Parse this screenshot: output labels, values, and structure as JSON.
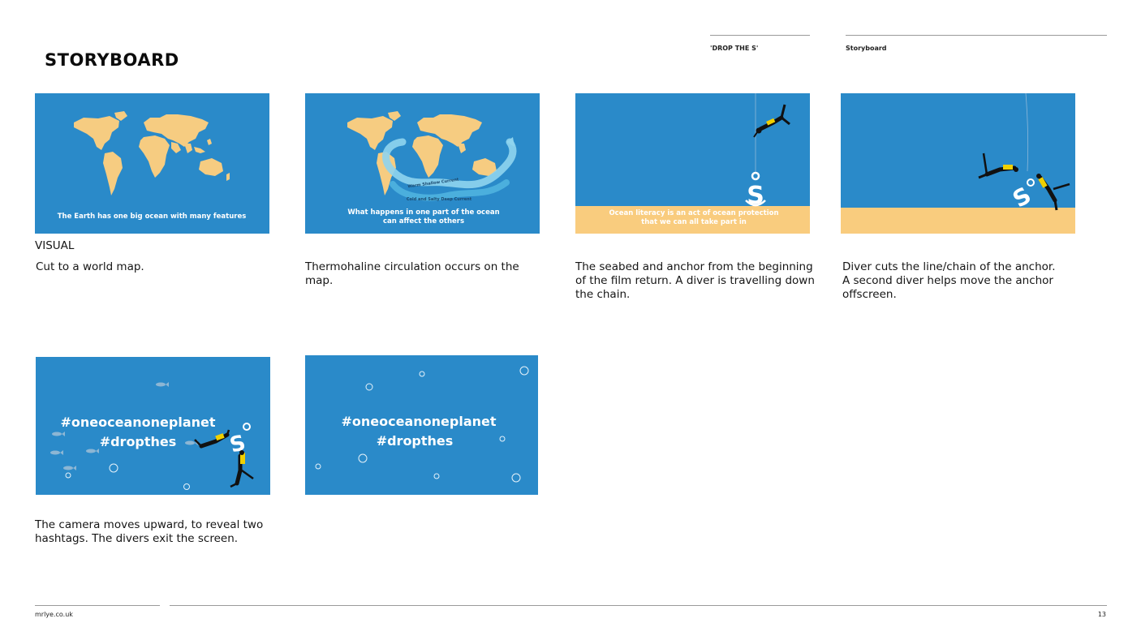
{
  "page": {
    "title": "STORYBOARD",
    "project_label": "'DROP THE S'",
    "section_label": "Storyboard",
    "visual_label": "VISUAL",
    "footer_site": "mrlye.co.uk",
    "page_number": "13"
  },
  "frames": [
    {
      "overlay_lines": [
        "The Earth has one big ocean with many features"
      ],
      "caption_lines": [
        "Cut to a world map."
      ]
    },
    {
      "overlay_lines": [
        "What happens in one part of the ocean",
        "can affect the others"
      ],
      "current_labels": [
        "Warm Shallow Current",
        "Cold and Salty Deep Current"
      ],
      "caption_lines": [
        "Thermohaline circulation occurs on the",
        "map."
      ]
    },
    {
      "overlay_lines": [
        "Ocean literacy is an act of ocean protection",
        "that we can all take part in"
      ],
      "caption_lines": [
        "The seabed and anchor from the beginning",
        "of the film return. A diver is travelling down",
        "the chain."
      ]
    },
    {
      "overlay_lines": [],
      "caption_lines": [
        "Diver cuts the line/chain of the anchor.",
        "A second diver helps move the anchor",
        "offscreen."
      ]
    },
    {
      "overlay_lines": [
        "#oneoceanoneplanet",
        "#dropthes"
      ],
      "caption_lines": [
        "The camera moves upward, to reveal two",
        "hashtags. The divers exit the screen."
      ]
    },
    {
      "overlay_lines": [
        "#oneoceanoneplanet",
        "#dropthes"
      ],
      "caption_lines": []
    }
  ],
  "colors": {
    "ocean": "#2a8ac9",
    "land": "#f6cc81",
    "seabed": "#f9cc7e",
    "current": "#8fd4ee",
    "diver_suit": "#111111",
    "diver_tank": "#f0d000"
  }
}
